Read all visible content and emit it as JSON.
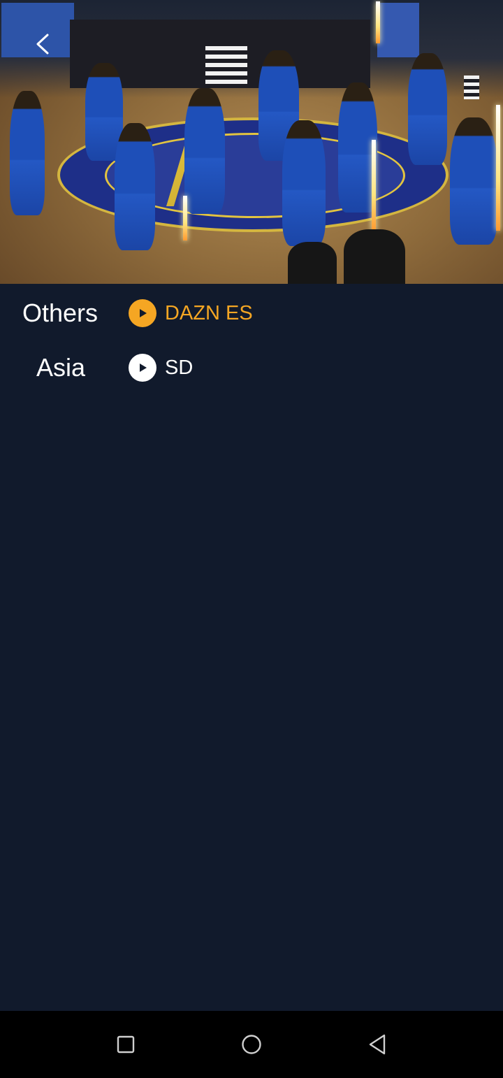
{
  "video": {
    "back_icon": "chevron-left-icon"
  },
  "streams": [
    {
      "region": "Others",
      "label": "DAZN ES",
      "icon": "play-circle-icon",
      "accent": "#f5a623"
    },
    {
      "region": "Asia",
      "label": "SD",
      "icon": "play-circle-icon",
      "accent": "#ffffff"
    }
  ],
  "navbar": {
    "recents_icon": "square-icon",
    "home_icon": "circle-icon",
    "back_icon": "triangle-back-icon"
  },
  "colors": {
    "background": "#111a2c",
    "accent_orange": "#f5a623",
    "text_white": "#ffffff",
    "navbar": "#000000"
  }
}
